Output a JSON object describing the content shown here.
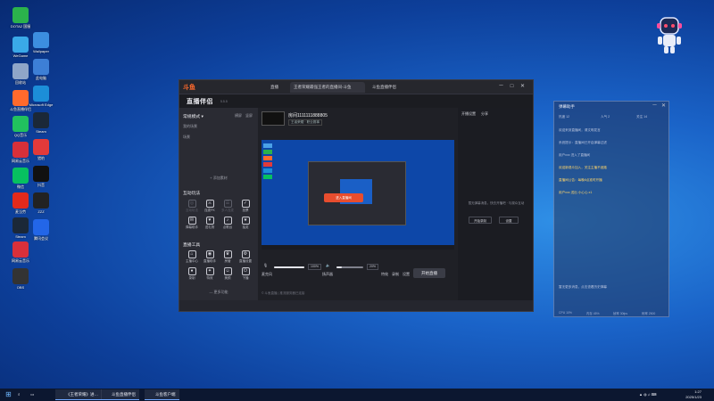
{
  "desktop": {
    "icons": [
      {
        "label": "DOTA2 国服",
        "color": "#2bb24c"
      },
      {
        "label": "Wallpaper",
        "color": "#3c8ee0"
      },
      {
        "label": "WeGame",
        "color": "#3aa9e8"
      },
      {
        "label": "此电脑",
        "color": "#3d7fd6"
      },
      {
        "label": "回收站",
        "color": "#8fa6c8"
      },
      {
        "label": "Microsoft Edge",
        "color": "#1c8ed8"
      },
      {
        "label": "斗鱼直播伴侣",
        "color": "#ff6a2c"
      },
      {
        "label": "Steam",
        "color": "#1b2838"
      },
      {
        "label": "QQ音乐",
        "color": "#21c15e"
      },
      {
        "label": "猎豹",
        "color": "#e23a3a"
      },
      {
        "label": "网易云音乐",
        "color": "#d8303a"
      },
      {
        "label": "抖音",
        "color": "#111111"
      },
      {
        "label": "微信",
        "color": "#07c160"
      },
      {
        "label": "ZZZ",
        "color": "#222"
      },
      {
        "label": "麦当劳",
        "color": "#e32a1c"
      },
      {
        "label": "腾讯会议",
        "color": "#2366e8"
      },
      {
        "label": "Steam",
        "color": "#1b2838"
      },
      {
        "label": "网易云音乐",
        "color": "#d8303a"
      },
      {
        "label": "OBS",
        "color": "#333"
      }
    ]
  },
  "browser": {
    "logo": "斗鱼",
    "tabs": [
      "",
      "直播",
      "王者荣耀最强王者的直播间-斗鱼",
      "斗鱼直播伴侣"
    ],
    "controls": [
      "－",
      "□",
      "✕"
    ]
  },
  "app": {
    "name": "直播伴侣",
    "version": "5.5.5",
    "scene_label": "常规模式 ▾",
    "scene_tabs": [
      "横屏",
      "竖屏"
    ],
    "scene_list_title": "我的场景",
    "scene_item": "场景",
    "add_material": "+ 添加素材",
    "interactive_title": "互动玩法",
    "interactive_tools": [
      {
        "label": "互动玩法",
        "dim": true
      },
      {
        "label": "连麦PK",
        "dim": false
      },
      {
        "label": "多人连麦",
        "dim": true
      },
      {
        "label": "投票",
        "dim": false
      },
      {
        "label": "弹幕助手",
        "dim": false
      },
      {
        "label": "送礼物",
        "dim": false
      },
      {
        "label": "点歌台",
        "dim": false
      },
      {
        "label": "抽奖",
        "dim": false
      }
    ],
    "tools_title": "直播工具",
    "tools": [
      {
        "label": "主播中心"
      },
      {
        "label": "直播助手"
      },
      {
        "label": "房管"
      },
      {
        "label": "直播设置"
      },
      {
        "label": "录制"
      },
      {
        "label": "特效"
      },
      {
        "label": "美颜"
      },
      {
        "label": "下播"
      }
    ],
    "more_label": "— 更多功能",
    "room_title": "房间1111111888805",
    "room_sub": "王者荣耀 · 职业赛事",
    "right_header": [
      "开播设置",
      "分享"
    ],
    "right_empty_text": "暂无弹幕消息，快去开播吧 · 与观众互动",
    "right_buttons": [
      "开始录制",
      "设置"
    ],
    "mic_label": "麦克风",
    "mic_pct": "100%",
    "speaker_label": "扬声器",
    "speaker_pct": "20%",
    "btn_labels": [
      "特效",
      "录制",
      "设置"
    ],
    "go_live": "开始直播",
    "footer": "© 斗鱼直播 | 推流服务器已连接",
    "inner_dialog": "进入直播间"
  },
  "side_window": {
    "title": "弹幕助手",
    "tabs": [
      "热度 12",
      "人气 2",
      "关注 14"
    ],
    "lines": [
      {
        "text": "欢迎来到直播间，请文明发言",
        "hl": false
      },
      {
        "text": "系统提示：直播间已开启弹幕过滤",
        "hl": false
      },
      {
        "text": "用户xxx 进入了直播间",
        "hl": false
      },
      {
        "text": "欢迎新观众加入，关注主播不迷路",
        "hl": true
      },
      {
        "text": "直播间公告：每晚8点准时开播",
        "hl": true
      },
      {
        "text": "用户xxx 送出 小心心 x1",
        "hl": true
      }
    ],
    "footer_text": "暂无更多消息，点击查看历史弹幕",
    "stats": [
      "CPU 10%",
      "内存 45%",
      "帧率 30fps",
      "码率 2500"
    ]
  },
  "taskbar": {
    "tasks": [
      "《王者荣耀》进…",
      "斗鱼直播伴侣",
      "斗鱼客户端"
    ],
    "time": "1:27",
    "date": "2025/1/23"
  }
}
